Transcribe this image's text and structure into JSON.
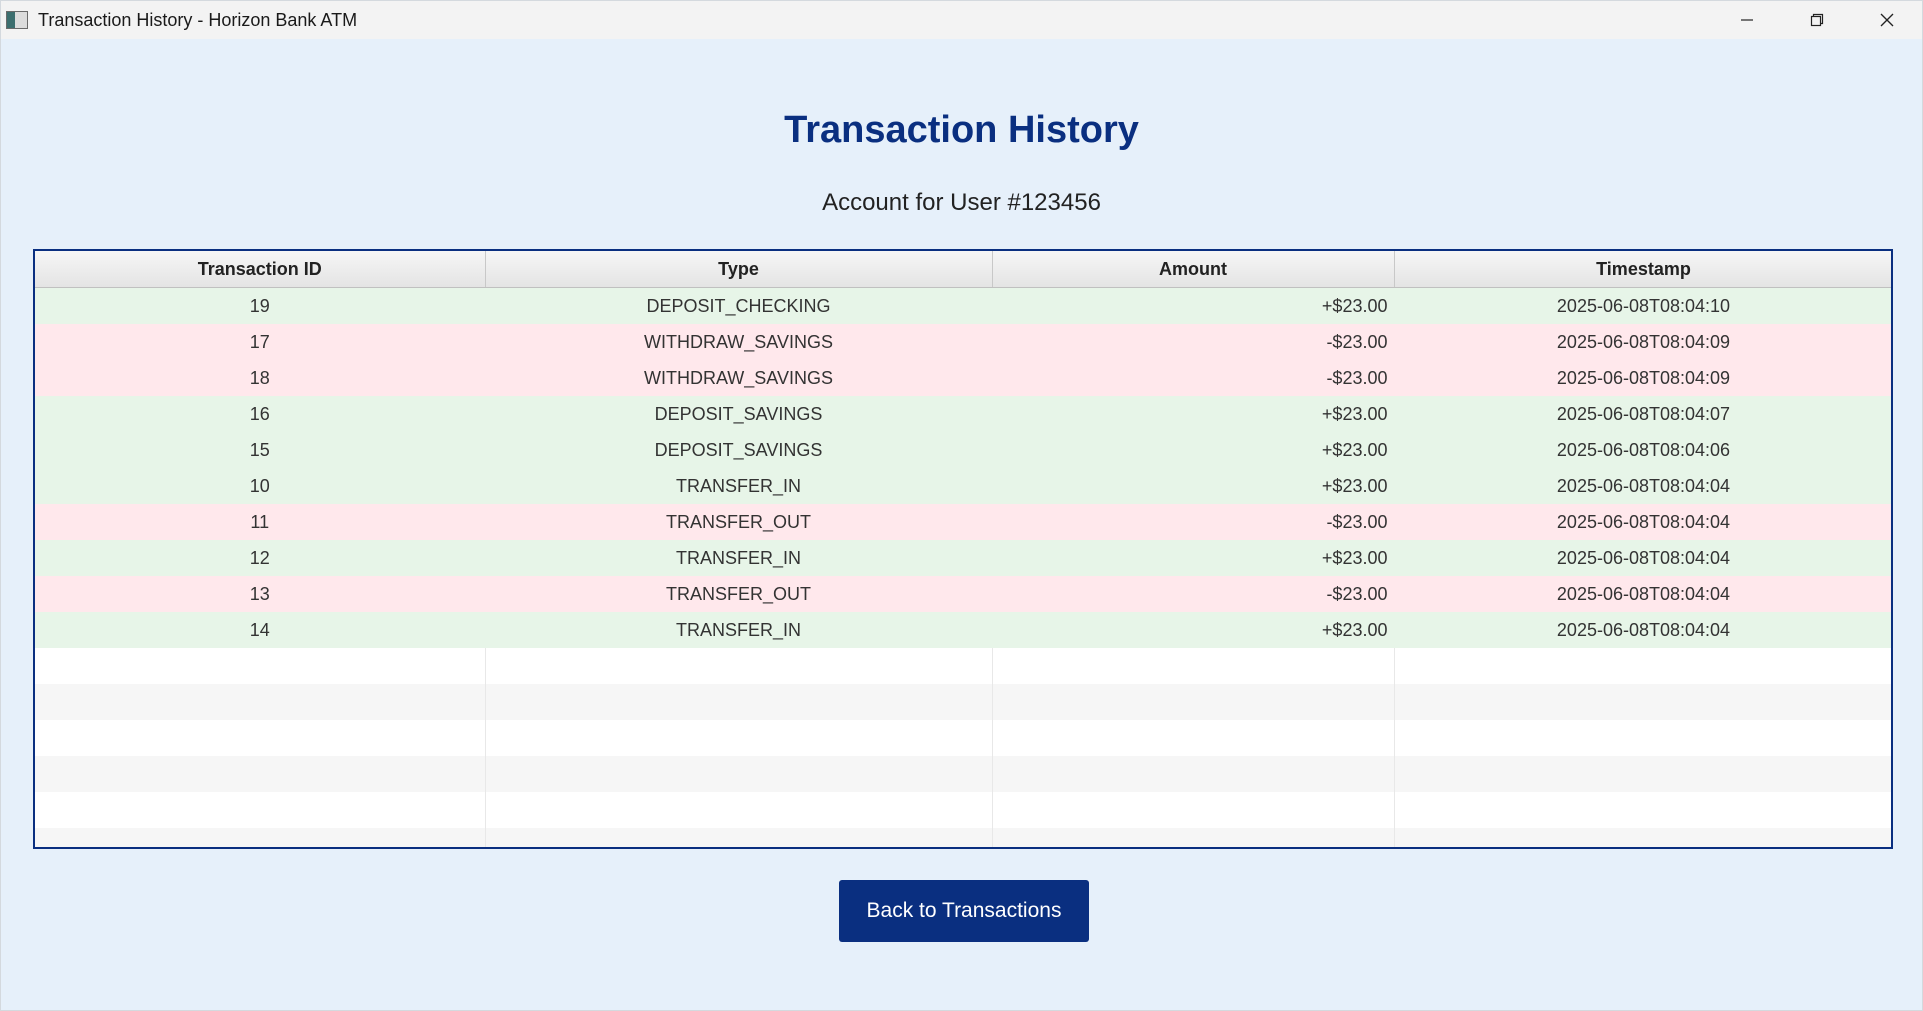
{
  "window": {
    "title": "Transaction History - Horizon Bank ATM",
    "controls": [
      "minimize-icon",
      "restore-icon",
      "close-icon"
    ]
  },
  "header": {
    "title": "Transaction History",
    "subtitle": "Account for User #123456"
  },
  "colors": {
    "title": "#0a2f80",
    "button": "#0a2f80",
    "credit_row": "#e7f5e8",
    "debit_row": "#ffe8ec",
    "background": "#e6f0fa"
  },
  "table": {
    "columns": [
      "Transaction ID",
      "Type",
      "Amount",
      "Timestamp"
    ],
    "rows": [
      {
        "id": "19",
        "type": "DEPOSIT_CHECKING",
        "amount": "+$23.00",
        "timestamp": "2025-06-08T08:04:10",
        "kind": "credit"
      },
      {
        "id": "17",
        "type": "WITHDRAW_SAVINGS",
        "amount": "-$23.00",
        "timestamp": "2025-06-08T08:04:09",
        "kind": "debit"
      },
      {
        "id": "18",
        "type": "WITHDRAW_SAVINGS",
        "amount": "-$23.00",
        "timestamp": "2025-06-08T08:04:09",
        "kind": "debit"
      },
      {
        "id": "16",
        "type": "DEPOSIT_SAVINGS",
        "amount": "+$23.00",
        "timestamp": "2025-06-08T08:04:07",
        "kind": "credit"
      },
      {
        "id": "15",
        "type": "DEPOSIT_SAVINGS",
        "amount": "+$23.00",
        "timestamp": "2025-06-08T08:04:06",
        "kind": "credit"
      },
      {
        "id": "10",
        "type": "TRANSFER_IN",
        "amount": "+$23.00",
        "timestamp": "2025-06-08T08:04:04",
        "kind": "credit"
      },
      {
        "id": "11",
        "type": "TRANSFER_OUT",
        "amount": "-$23.00",
        "timestamp": "2025-06-08T08:04:04",
        "kind": "debit"
      },
      {
        "id": "12",
        "type": "TRANSFER_IN",
        "amount": "+$23.00",
        "timestamp": "2025-06-08T08:04:04",
        "kind": "credit"
      },
      {
        "id": "13",
        "type": "TRANSFER_OUT",
        "amount": "-$23.00",
        "timestamp": "2025-06-08T08:04:04",
        "kind": "debit"
      },
      {
        "id": "14",
        "type": "TRANSFER_IN",
        "amount": "+$23.00",
        "timestamp": "2025-06-08T08:04:04",
        "kind": "credit"
      }
    ]
  },
  "actions": {
    "back_label": "Back to Transactions"
  }
}
